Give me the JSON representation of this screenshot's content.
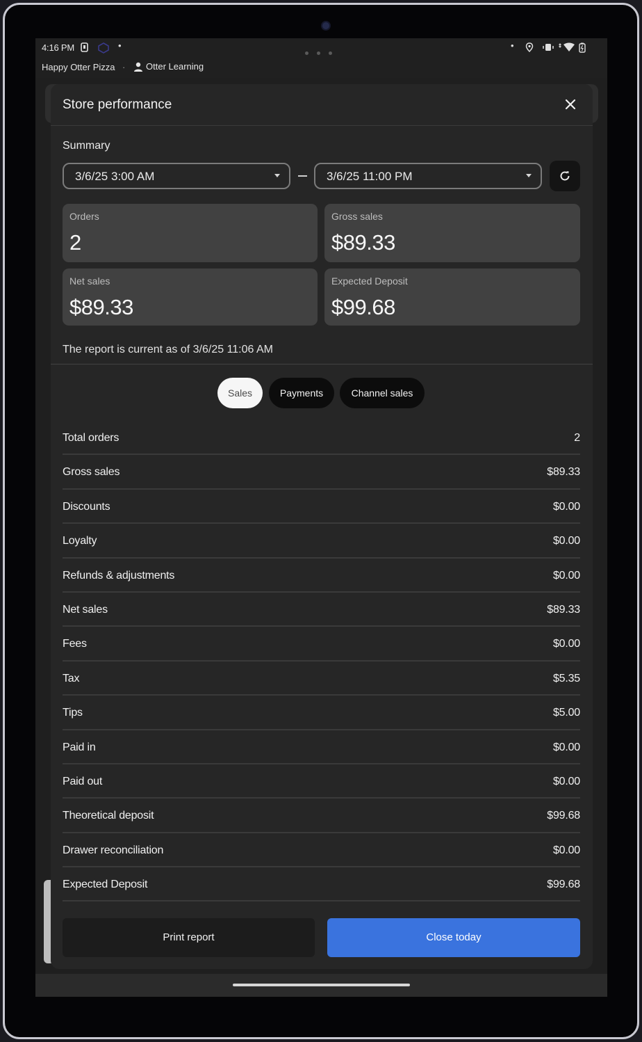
{
  "statusbar": {
    "time": "4:16 PM"
  },
  "appbar": {
    "store_name": "Happy Otter Pizza",
    "separator": "·",
    "user_name": "Otter Learning"
  },
  "sheet": {
    "title": "Store performance",
    "summary_label": "Summary",
    "date_range": {
      "start": "3/6/25 3:00 AM",
      "end": "3/6/25 11:00 PM"
    },
    "cards": {
      "orders": {
        "label": "Orders",
        "value": "2"
      },
      "gross_sales": {
        "label": "Gross sales",
        "value": "$89.33"
      },
      "net_sales": {
        "label": "Net sales",
        "value": "$89.33"
      },
      "expected_deposit": {
        "label": "Expected Deposit",
        "value": "$99.68"
      }
    },
    "as_of": "The report is current as of 3/6/25 11:06 AM",
    "tabs": [
      {
        "label": "Sales",
        "active": true
      },
      {
        "label": "Payments",
        "active": false
      },
      {
        "label": "Channel sales",
        "active": false
      }
    ],
    "rows": [
      {
        "label": "Total orders",
        "value": "2"
      },
      {
        "label": "Gross sales",
        "value": "$89.33"
      },
      {
        "label": "Discounts",
        "value": "$0.00"
      },
      {
        "label": "Loyalty",
        "value": "$0.00"
      },
      {
        "label": "Refunds & adjustments",
        "value": "$0.00"
      },
      {
        "label": "Net sales",
        "value": "$89.33"
      },
      {
        "label": "Fees",
        "value": "$0.00"
      },
      {
        "label": "Tax",
        "value": "$5.35"
      },
      {
        "label": "Tips",
        "value": "$5.00"
      },
      {
        "label": "Paid in",
        "value": "$0.00"
      },
      {
        "label": "Paid out",
        "value": "$0.00"
      },
      {
        "label": "Theoretical deposit",
        "value": "$99.68"
      },
      {
        "label": "Drawer reconciliation",
        "value": "$0.00"
      },
      {
        "label": "Expected Deposit",
        "value": "$99.68"
      }
    ],
    "buttons": {
      "print": "Print report",
      "close_today": "Close today"
    }
  },
  "colors": {
    "primary_button": "#3a73de",
    "background": "#1f1f1f",
    "card": "#414141"
  },
  "icons": [
    "close-icon",
    "refresh-icon",
    "chevron-down-icon",
    "person-icon",
    "location-icon",
    "wifi-icon",
    "battery-icon"
  ]
}
